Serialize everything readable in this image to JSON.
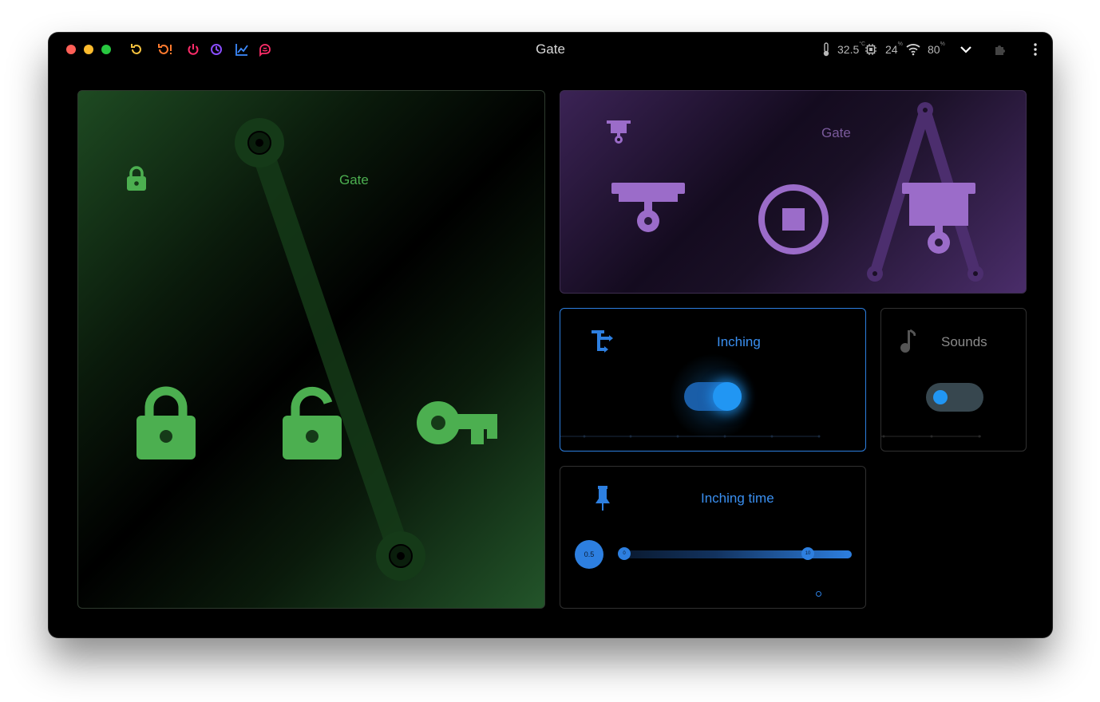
{
  "window": {
    "title": "Gate"
  },
  "titlebar": {
    "buttons": [
      "refresh-icon",
      "restart-alert-icon",
      "power-icon",
      "history-icon",
      "chart-icon",
      "brain-icon"
    ],
    "status": {
      "temperature": "32.5",
      "temperature_unit": "°C",
      "cpu": "24",
      "cpu_unit": "%",
      "wifi": "80",
      "wifi_unit": "%"
    }
  },
  "lock_card": {
    "title": "Gate",
    "state_icon": "lock-icon",
    "actions": [
      "lock-icon",
      "unlock-icon",
      "key-icon"
    ]
  },
  "gate_card": {
    "title": "Gate",
    "state_icon": "gate-icon",
    "actions": [
      "gate-close-icon",
      "stop-icon",
      "gate-open-icon"
    ]
  },
  "inching_card": {
    "title": "Inching",
    "icon": "shuffle-icon",
    "toggle_on": true
  },
  "sounds_card": {
    "title": "Sounds",
    "icon": "music-note-icon",
    "toggle_on": false
  },
  "inching_time_card": {
    "title": "Inching time",
    "icon": "pin-icon",
    "value": "0.5",
    "min": "0",
    "max": "10"
  },
  "colors": {
    "lock_green": "#4caf50",
    "gate_purple": "#9b6cc9",
    "accent_blue": "#2d7fe0",
    "toggle_blue": "#2196f3"
  }
}
